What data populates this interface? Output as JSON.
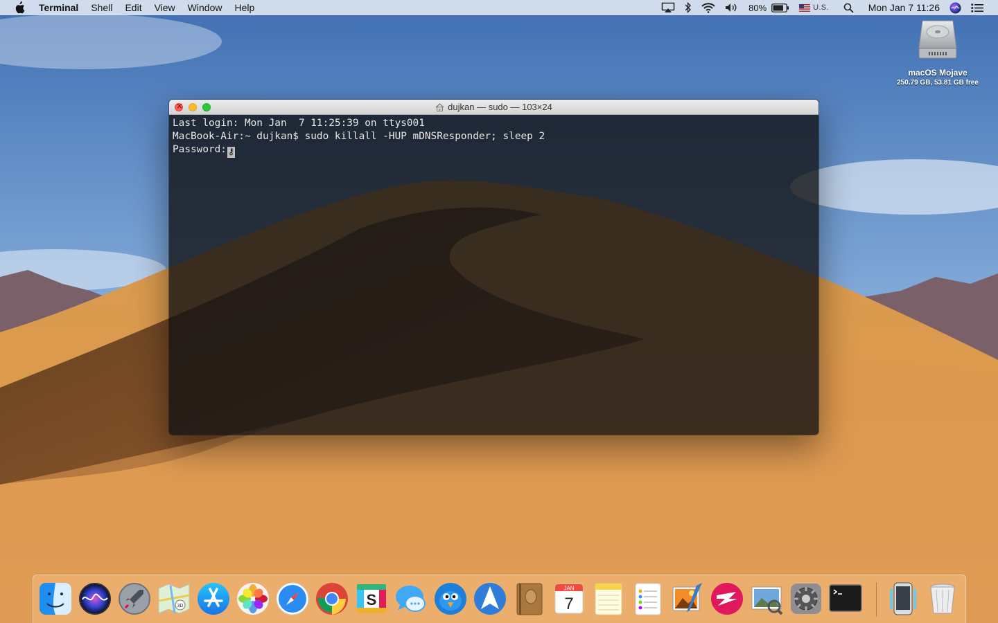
{
  "menubar": {
    "app_name": "Terminal",
    "menus": [
      "Shell",
      "Edit",
      "View",
      "Window",
      "Help"
    ],
    "battery_percent": "80%",
    "input_source": "U.S.",
    "clock": "Mon Jan 7  11:26"
  },
  "desktop": {
    "disk_name": "macOS Mojave",
    "disk_info": "250.79 GB, 53.81 GB free"
  },
  "terminal": {
    "title": "dujkan — sudo — 103×24",
    "lines": [
      "Last login: Mon Jan  7 11:25:39 on ttys001",
      "MacBook-Air:~ dujkan$ sudo killall -HUP mDNSResponder; sleep 2",
      "Password:"
    ],
    "cursor_glyph": "⚷"
  },
  "dock": {
    "apps": [
      {
        "icon": "finder-icon",
        "running": true
      },
      {
        "icon": "siri-icon",
        "running": false
      },
      {
        "icon": "launchpad-icon",
        "running": false
      },
      {
        "icon": "maps-icon",
        "running": false
      },
      {
        "icon": "app-store-icon",
        "running": false
      },
      {
        "icon": "photos-icon",
        "running": false
      },
      {
        "icon": "safari-icon",
        "running": true
      },
      {
        "icon": "chrome-icon",
        "running": false
      },
      {
        "icon": "slack-icon",
        "running": false
      },
      {
        "icon": "messages-icon",
        "running": false
      },
      {
        "icon": "tweetbot-icon",
        "running": false
      },
      {
        "icon": "spark-icon",
        "running": false
      },
      {
        "icon": "notefile-icon",
        "running": false
      },
      {
        "icon": "calendar-icon",
        "running": false
      },
      {
        "icon": "notes-icon",
        "running": false
      },
      {
        "icon": "reminders-icon",
        "running": false
      },
      {
        "icon": "pixelmator-icon",
        "running": false
      },
      {
        "icon": "skitch-icon",
        "running": false
      },
      {
        "icon": "preview-icon",
        "running": false
      },
      {
        "icon": "system-preferences-icon",
        "running": false
      },
      {
        "icon": "terminal-icon",
        "running": true
      },
      {
        "icon": "iphone-backup-icon",
        "running": false
      },
      {
        "icon": "trash-icon",
        "running": false
      }
    ],
    "calendar_month": "JAN",
    "calendar_day": "7"
  },
  "colors": {
    "sky": "#5a89c4",
    "sand": "#d9924a",
    "terminal_bg": "#121214",
    "terminal_fg": "#e8e8e8"
  }
}
